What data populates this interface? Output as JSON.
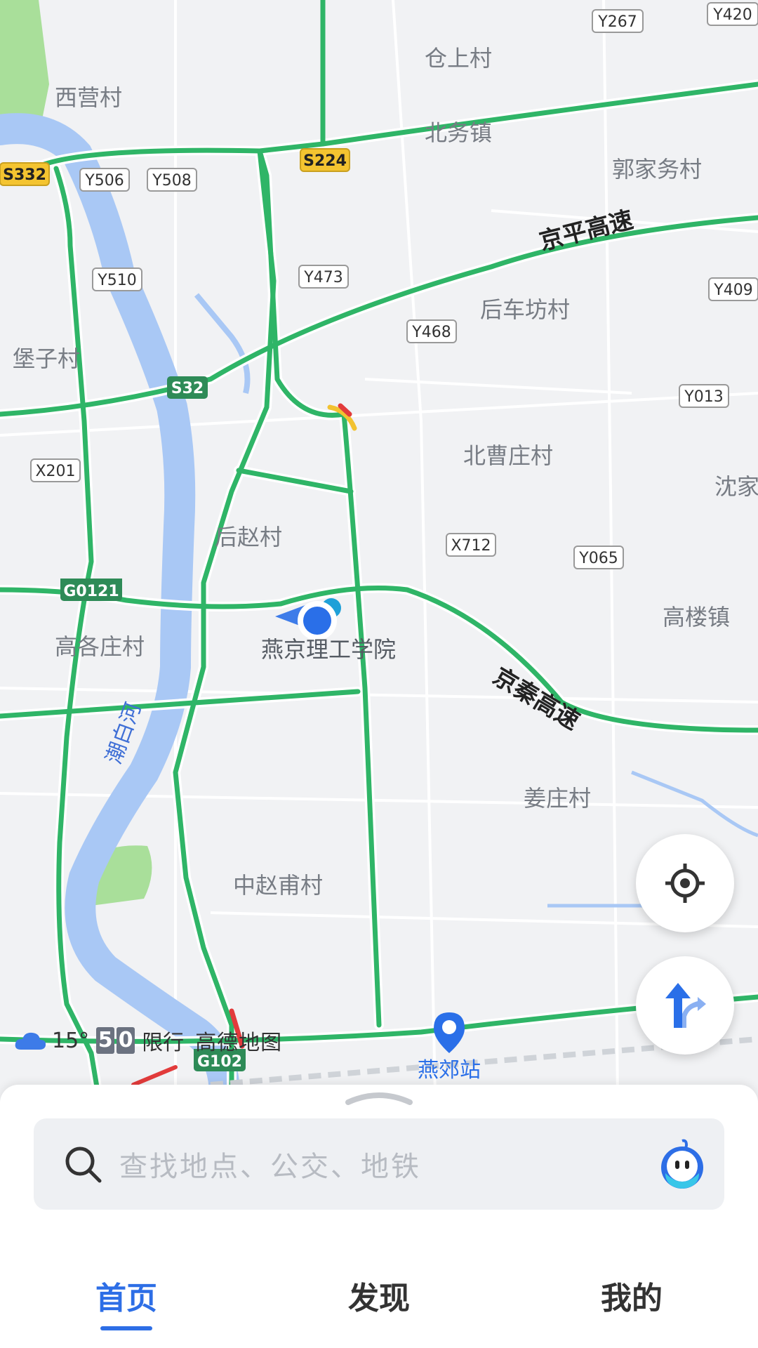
{
  "map": {
    "places": [
      "仓上村",
      "西营村",
      "北务镇",
      "郭家务村",
      "后车坊村",
      "堡子村",
      "北曹庄村",
      "沈家",
      "后赵村",
      "高楼镇",
      "高各庄村",
      "姜庄村",
      "中赵甫村",
      "燕郊站"
    ],
    "poi_current": "燕京理工学院",
    "river": "潮白河",
    "highways": [
      "京平高速",
      "京秦高速"
    ],
    "road_badges": [
      "Y267",
      "Y420",
      "Y506",
      "Y508",
      "Y510",
      "Y473",
      "Y468",
      "Y409",
      "Y013",
      "X201",
      "X712",
      "Y065"
    ],
    "shields": {
      "s332": "S332",
      "s224": "S224",
      "s32": "S32",
      "g0121": "G0121",
      "g102": "G102"
    },
    "colors": {
      "road": "#2fb567",
      "road_outline": "#ffffff",
      "river": "#a9c8f5",
      "park": "#a9df9a",
      "congested": "#e23b3b",
      "slow": "#f2c230",
      "location": "#2a6fe8"
    }
  },
  "status": {
    "temperature": "15°",
    "plate_digits": [
      "5",
      "0"
    ],
    "restriction_label": "限行",
    "brand": "高德地图"
  },
  "search": {
    "placeholder": "查找地点、公交、地铁"
  },
  "tabs": {
    "home": "首页",
    "discover": "发现",
    "mine": "我的"
  }
}
